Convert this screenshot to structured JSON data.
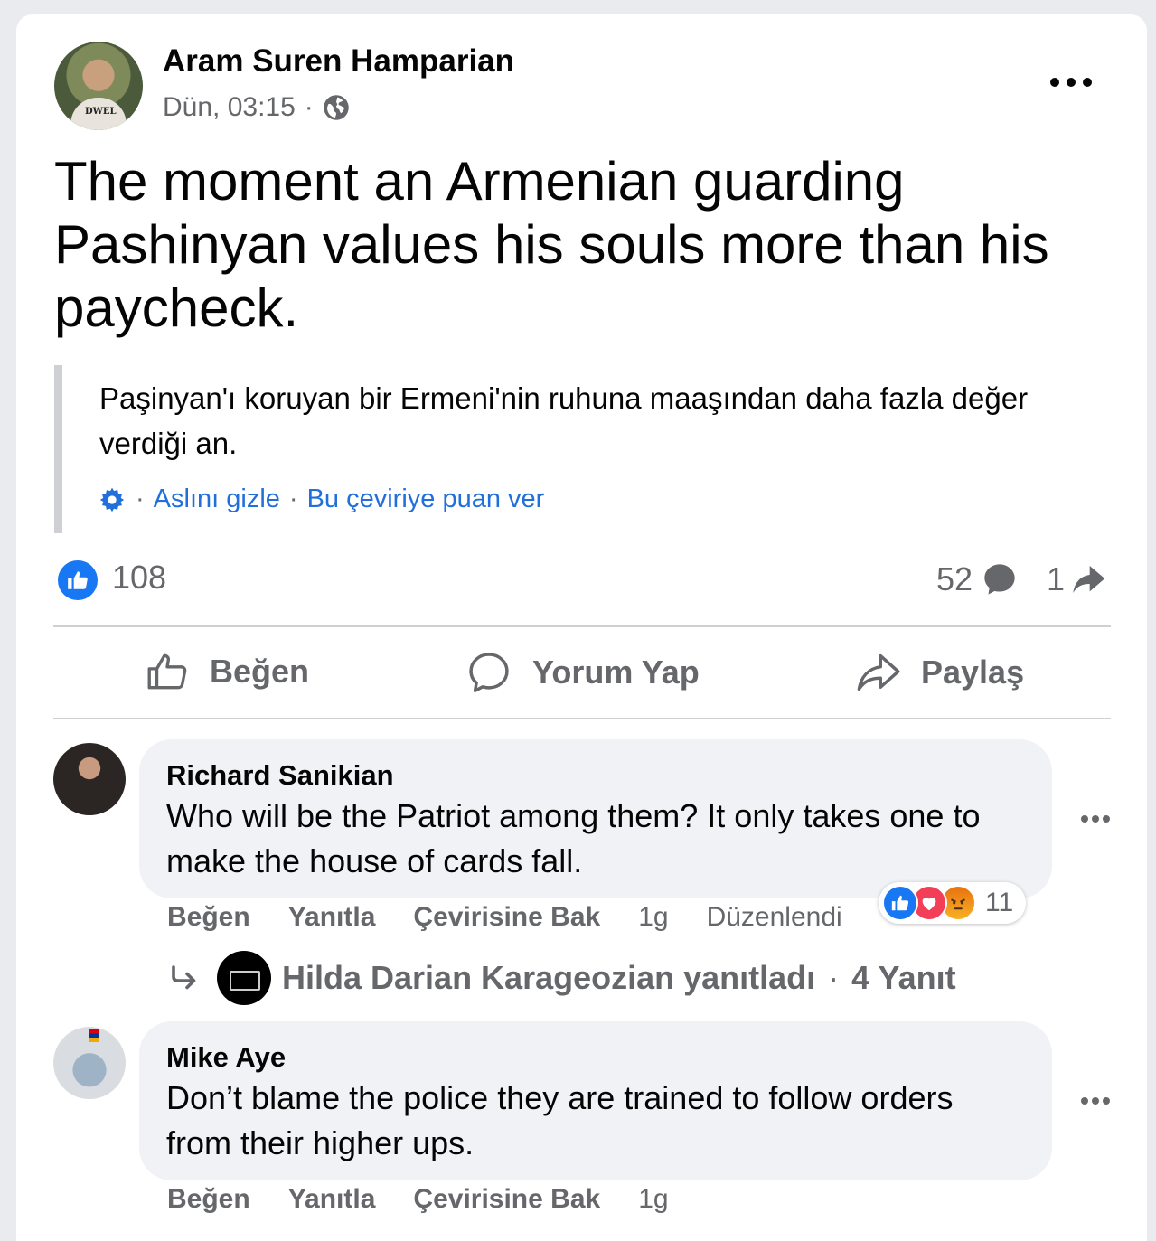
{
  "post": {
    "author": "Aram Suren Hamparian",
    "time": "Dün, 03:15",
    "dot": "·",
    "avatar_shirt_text": "DWEL",
    "text": "The moment an Armenian guarding Pashinyan values his souls more than his paycheck.",
    "translation": "Paşinyan'ı koruyan bir Ermeni'nin ruhuna maaşından daha fazla değer verdiği an.",
    "translation_links": {
      "sep": "·",
      "hide_original": "Aslını gizle",
      "rate": "Bu çeviriye puan ver"
    },
    "reaction_count": "108",
    "comment_count": "52",
    "share_count": "1"
  },
  "actions": {
    "like": "Beğen",
    "comment": "Yorum Yap",
    "share": "Paylaş"
  },
  "comments": [
    {
      "name": "Richard Sanikian",
      "text": "Who will be the Patriot among them? It only takes one to make the house of cards fall.",
      "like": "Beğen",
      "reply": "Yanıtla",
      "translate": "Çevirisine Bak",
      "age": "1g",
      "edited": "Düzenlendi",
      "reaction_count": "11",
      "reply_summary": {
        "text": "Hilda Darian Karageozian yanıtladı",
        "sep": "·",
        "count": "4 Yanıt"
      }
    },
    {
      "name": "Mike Aye",
      "text": "Don’t blame the police they are trained to follow orders from their higher ups.",
      "like": "Beğen",
      "reply": "Yanıtla",
      "translate": "Çevirisine Bak",
      "age": "1g"
    }
  ],
  "colors": {
    "accent": "#1877f2",
    "link": "#216fdb",
    "secondary_text": "#65676b",
    "bubble": "#f0f2f5",
    "love": "#f33e58"
  }
}
